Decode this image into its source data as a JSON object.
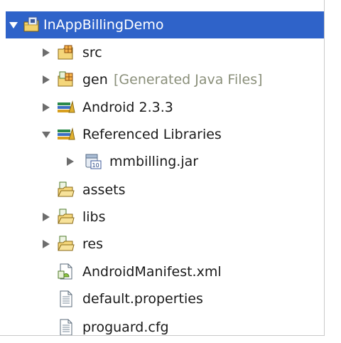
{
  "project": {
    "name": "InAppBillingDemo",
    "children": [
      {
        "label": "src",
        "decoration": ""
      },
      {
        "label": "gen",
        "decoration": "[Generated Java Files]"
      },
      {
        "label": "Android 2.3.3",
        "decoration": ""
      },
      {
        "label": "Referenced Libraries",
        "decoration": ""
      },
      {
        "label": "mmbilling.jar",
        "decoration": ""
      },
      {
        "label": "assets",
        "decoration": ""
      },
      {
        "label": "libs",
        "decoration": ""
      },
      {
        "label": "res",
        "decoration": ""
      },
      {
        "label": "AndroidManifest.xml",
        "decoration": ""
      },
      {
        "label": "default.properties",
        "decoration": ""
      },
      {
        "label": "proguard.cfg",
        "decoration": ""
      }
    ]
  },
  "icons": {
    "project": "project-folder-icon",
    "package": "package-folder-icon",
    "library": "library-icon",
    "jar": "jar-icon",
    "folder": "folder-icon",
    "manifest": "android-manifest-icon",
    "file": "text-file-icon"
  },
  "colors": {
    "selection": "#2f63c9",
    "decoration": "#8a8f7a",
    "text": "#1a1a1a"
  }
}
